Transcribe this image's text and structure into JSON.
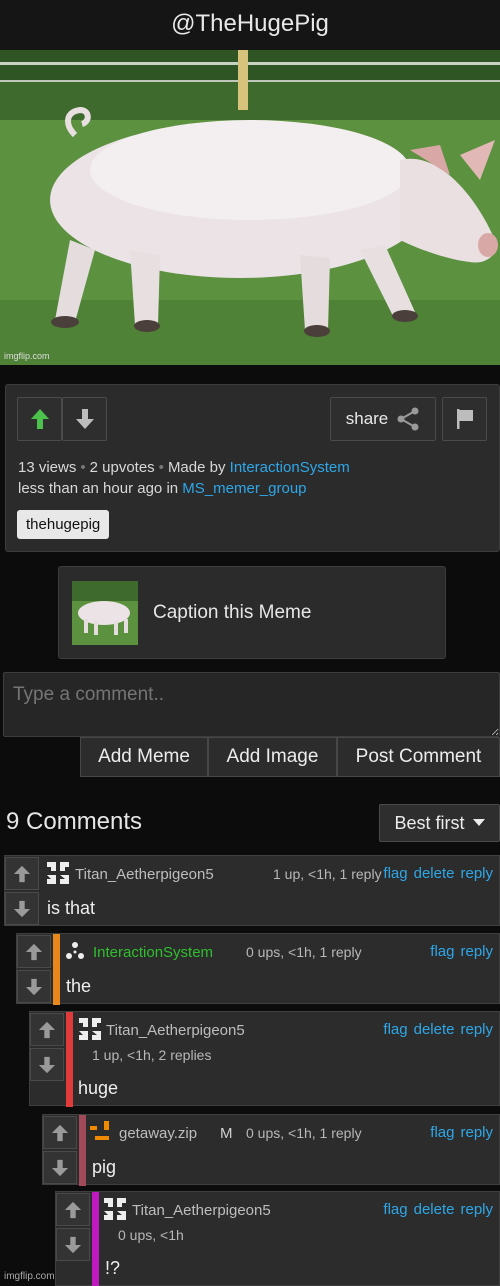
{
  "header": {
    "title": "@TheHugePig"
  },
  "meme": {
    "watermark": "imgflip.com"
  },
  "post": {
    "share_label": "share",
    "views": "13 views",
    "upvotes": "2 upvotes",
    "made_by_prefix": "Made by",
    "author": "InteractionSystem",
    "time_prefix": "less than an hour ago in",
    "group": "MS_memer_group",
    "tag": "thehugepig",
    "upvote_state": "active",
    "icons": [
      "upvote-arrow-icon",
      "downvote-arrow-icon",
      "share-icon",
      "flag-icon"
    ]
  },
  "caption": {
    "label": "Caption this Meme"
  },
  "composer": {
    "placeholder": "Type a comment..",
    "buttons": [
      "Add Meme",
      "Add Image",
      "Post Comment"
    ]
  },
  "comments_header": {
    "count_label": "9 Comments",
    "sort_label": "Best first"
  },
  "comments": [
    {
      "user": "Titan_Aetherpigeon5",
      "stats": "1 up, <1h, 1 reply",
      "actions": [
        "flag",
        "delete",
        "reply"
      ],
      "text": "is that",
      "bar_color": ""
    },
    {
      "user": "InteractionSystem",
      "stats": "0 ups, <1h, 1 reply",
      "actions": [
        "flag",
        "reply"
      ],
      "text": "the",
      "bar_color": "#e8871e"
    },
    {
      "user": "Titan_Aetherpigeon5",
      "stats": "1 up, <1h, 2 replies",
      "actions": [
        "flag",
        "delete",
        "reply"
      ],
      "text": "huge",
      "bar_color": "#e03a3a"
    },
    {
      "user": "getaway.zip",
      "badge": "M",
      "stats": "0 ups, <1h, 1 reply",
      "actions": [
        "flag",
        "reply"
      ],
      "text": "pig",
      "bar_color": "#a04a5a"
    },
    {
      "user": "Titan_Aetherpigeon5",
      "stats": "0 ups, <1h",
      "actions": [
        "flag",
        "delete",
        "reply"
      ],
      "text": "!?",
      "bar_color": "#c019c0"
    }
  ],
  "footer": {
    "watermark": "imgflip.com"
  }
}
